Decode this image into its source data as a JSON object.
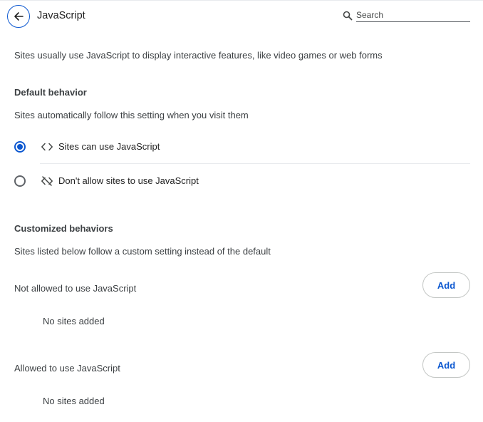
{
  "header": {
    "title": "JavaScript",
    "back_icon": "arrow-left-icon",
    "search": {
      "placeholder": "Search",
      "value": "",
      "icon": "search-icon"
    }
  },
  "description": "Sites usually use JavaScript to display interactive features, like video games or web forms",
  "default_behavior": {
    "heading": "Default behavior",
    "subtitle": "Sites automatically follow this setting when you visit them",
    "options": [
      {
        "label": "Sites can use JavaScript",
        "icon": "code-icon",
        "selected": true
      },
      {
        "label": "Don't allow sites to use JavaScript",
        "icon": "code-off-icon",
        "selected": false
      }
    ]
  },
  "customized": {
    "heading": "Customized behaviors",
    "subtitle": "Sites listed below follow a custom setting instead of the default",
    "lists": [
      {
        "title": "Not allowed to use JavaScript",
        "add_label": "Add",
        "empty_text": "No sites added"
      },
      {
        "title": "Allowed to use JavaScript",
        "add_label": "Add",
        "empty_text": "No sites added"
      }
    ]
  },
  "colors": {
    "accent": "#0b57d0",
    "text": "#1f1f1f",
    "secondary_text": "#3c4043",
    "divider": "#e8eaed"
  }
}
